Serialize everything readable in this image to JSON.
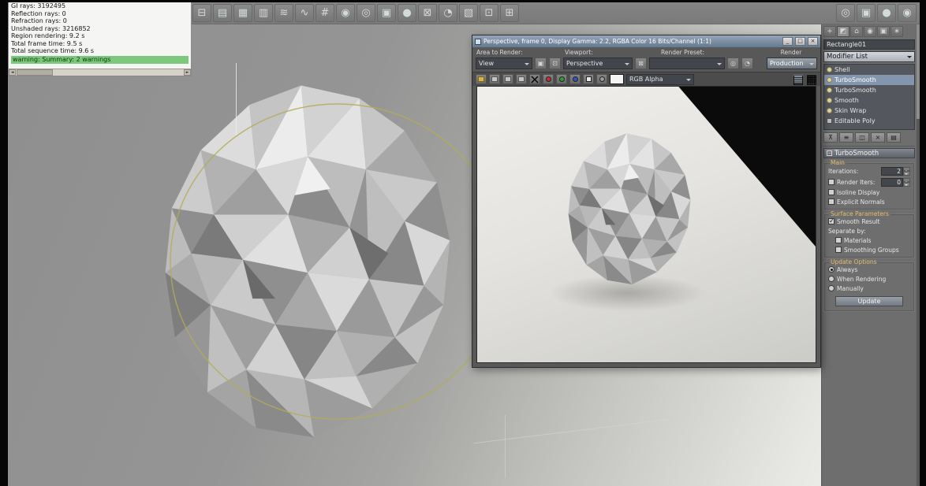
{
  "stats_window": {
    "lines": [
      "GI rays: 3192495",
      "Reflection rays: 0",
      "Refraction rays: 0",
      "Unshaded rays: 3216852",
      "Region rendering: 9.2 s",
      "Total frame time: 9.5 s",
      "Total sequence time: 9.6 s"
    ],
    "highlight": "warning: Summary: 2 warnings"
  },
  "toolbar": {
    "left_icons": [
      {
        "name": "mirror",
        "glyph": "◫"
      },
      {
        "name": "align",
        "glyph": "⊟"
      },
      {
        "name": "layer-manager",
        "glyph": "▤"
      },
      {
        "name": "scene-explorer",
        "glyph": "▦"
      },
      {
        "name": "named-selection-sets",
        "glyph": "▥"
      },
      {
        "name": "track-view",
        "glyph": "≋"
      },
      {
        "name": "curve-editor",
        "glyph": "∿"
      },
      {
        "name": "schematic-view",
        "glyph": "#"
      },
      {
        "name": "material-editor",
        "glyph": "◉"
      },
      {
        "name": "render-setup",
        "glyph": "◎"
      },
      {
        "name": "rendered-frame-window",
        "glyph": "▣"
      },
      {
        "name": "quick-render",
        "glyph": "●"
      },
      {
        "name": "snaps-toggle",
        "glyph": "⊠"
      },
      {
        "name": "angle-snap",
        "glyph": "◔"
      },
      {
        "name": "percent-snap",
        "glyph": "▧"
      },
      {
        "name": "spinner-snap",
        "glyph": "⊡"
      },
      {
        "name": "array-tool",
        "glyph": "⊞"
      }
    ],
    "right_icons": [
      {
        "name": "render-setup-2",
        "glyph": "◎"
      },
      {
        "name": "rendered-frame-2",
        "glyph": "▣"
      },
      {
        "name": "render-production",
        "glyph": "●"
      },
      {
        "name": "material-editor-2",
        "glyph": "◉"
      }
    ]
  },
  "render_window": {
    "title": "Perspective, frame 0, Display Gamma: 2.2, RGBA Color 16 Bits/Channel (1:1)",
    "titlebar_buttons": {
      "minimize": "_",
      "maximize": "□",
      "close": "×"
    },
    "labels": {
      "area_to_render": "Area to Render:",
      "viewport": "Viewport:",
      "render_preset": "Render Preset:",
      "render": "Render"
    },
    "controls": {
      "area_value": "View",
      "viewport_value": "Perspective",
      "preset_value": "",
      "render_mode": "Production",
      "channel_display": "RGB Alpha"
    }
  },
  "command_panel": {
    "tabs": [
      {
        "name": "create",
        "glyph": "+"
      },
      {
        "name": "modify",
        "glyph": "◩"
      },
      {
        "name": "hierarchy",
        "glyph": "⌂"
      },
      {
        "name": "motion",
        "glyph": "◉"
      },
      {
        "name": "display",
        "glyph": "▣"
      },
      {
        "name": "utilities",
        "glyph": "∗"
      }
    ],
    "object_name": "Rectangle01",
    "modifier_list_label": "Modifier List",
    "stack": [
      {
        "label": "Shell"
      },
      {
        "label": "TurboSmooth"
      },
      {
        "label": "TurboSmooth"
      },
      {
        "label": "Smooth"
      },
      {
        "label": "Skin Wrap"
      },
      {
        "label": "Editable Poly"
      }
    ],
    "rollout": {
      "title": "TurboSmooth",
      "groups": {
        "main": "Main",
        "surface": "Surface Parameters",
        "update": "Update Options"
      },
      "fields": {
        "iterations_label": "Iterations:",
        "iterations_value": "2",
        "render_iters_label": "Render Iters:",
        "render_iters_value": "0",
        "isoline_label": "Isoline Display",
        "explicit_label": "Explicit Normals",
        "smooth_result_label": "Smooth Result",
        "separate_by_label": "Separate by:",
        "materials_label": "Materials",
        "smoothing_groups_label": "Smoothing Groups",
        "always_label": "Always",
        "when_rendering_label": "When Rendering",
        "manually_label": "Manually",
        "update_button": "Update"
      }
    }
  },
  "colors": {
    "stack_selection": "#8496ae",
    "warning_highlight": "#7ec87e",
    "gizmo_yellow": "#b3ab57",
    "render_black_region": "#0b0b0b"
  }
}
